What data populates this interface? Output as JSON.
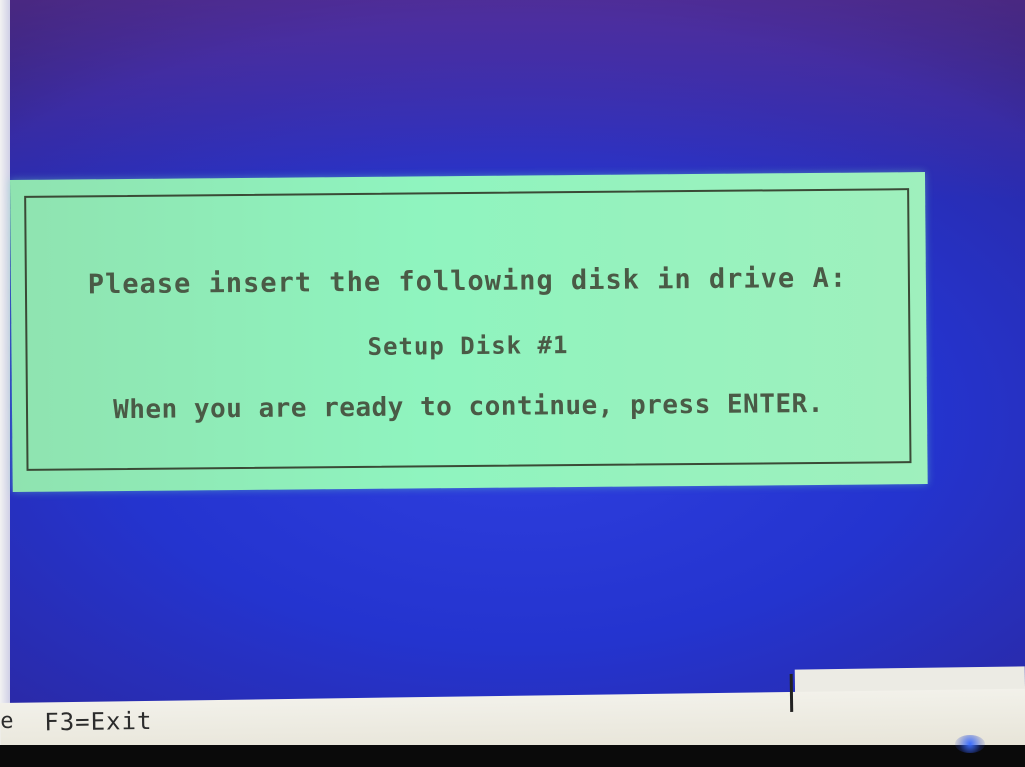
{
  "dialog": {
    "line1": "Please insert the following disk in drive A:",
    "line2": "Setup Disk #1",
    "line3": "When you are ready to continue, press ENTER."
  },
  "status_bar": {
    "edge_char": "e",
    "exit_hint": "F3=Exit"
  },
  "colors": {
    "screen_background": "#2434cf",
    "dialog_background": "#8ff4bf",
    "dialog_text": "#4a5a46",
    "status_background": "#f2f1ea"
  }
}
